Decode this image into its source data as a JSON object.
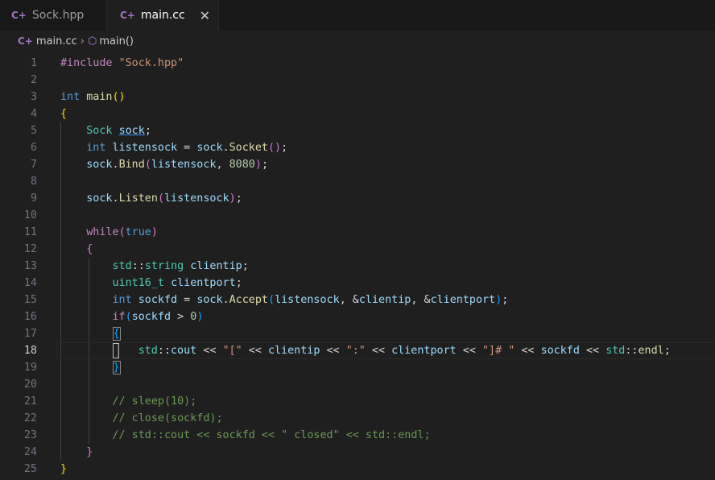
{
  "tabs": [
    {
      "label": "Sock.hpp",
      "icon": "c-plus-plus-icon"
    },
    {
      "label": "main.cc",
      "icon": "c-plus-plus-icon",
      "active": true,
      "close": "✕"
    }
  ],
  "breadcrumb": {
    "file": "main.cc",
    "sep": "›",
    "symbol": "main()"
  },
  "current_line": 18,
  "lines": [
    [
      [
        "#include ",
        "kwc"
      ],
      [
        "\"Sock.hpp\"",
        "str"
      ]
    ],
    [],
    [
      [
        "int",
        "kw"
      ],
      [
        " ",
        ""
      ],
      [
        "main",
        "fn"
      ],
      [
        "()",
        "br1"
      ]
    ],
    [
      [
        "{",
        "br1"
      ]
    ],
    [
      [
        "    ",
        ""
      ],
      [
        "Sock",
        "typ"
      ],
      [
        " ",
        ""
      ],
      [
        "sock",
        "var ul"
      ],
      [
        ";",
        "op"
      ]
    ],
    [
      [
        "    ",
        ""
      ],
      [
        "int",
        "kw"
      ],
      [
        " ",
        ""
      ],
      [
        "listensock",
        "var"
      ],
      [
        " = ",
        "op"
      ],
      [
        "sock",
        "var"
      ],
      [
        ".",
        "op"
      ],
      [
        "Socket",
        "fn"
      ],
      [
        "()",
        "br2"
      ],
      [
        ";",
        "op"
      ]
    ],
    [
      [
        "    ",
        ""
      ],
      [
        "sock",
        "var"
      ],
      [
        ".",
        "op"
      ],
      [
        "Bind",
        "fn"
      ],
      [
        "(",
        "br2"
      ],
      [
        "listensock",
        "var"
      ],
      [
        ", ",
        "op"
      ],
      [
        "8080",
        "num"
      ],
      [
        ")",
        "br2"
      ],
      [
        ";",
        "op"
      ]
    ],
    [],
    [
      [
        "    ",
        ""
      ],
      [
        "sock",
        "var"
      ],
      [
        ".",
        "op"
      ],
      [
        "Listen",
        "fn"
      ],
      [
        "(",
        "br2"
      ],
      [
        "listensock",
        "var"
      ],
      [
        ")",
        "br2"
      ],
      [
        ";",
        "op"
      ]
    ],
    [],
    [
      [
        "    ",
        ""
      ],
      [
        "while",
        "kwc"
      ],
      [
        "(",
        "br2"
      ],
      [
        "true",
        "kw"
      ],
      [
        ")",
        "br2"
      ]
    ],
    [
      [
        "    ",
        ""
      ],
      [
        "{",
        "br2"
      ]
    ],
    [
      [
        "        ",
        ""
      ],
      [
        "std",
        "typ"
      ],
      [
        "::",
        "op"
      ],
      [
        "string",
        "typ"
      ],
      [
        " ",
        ""
      ],
      [
        "clientip",
        "var"
      ],
      [
        ";",
        "op"
      ]
    ],
    [
      [
        "        ",
        ""
      ],
      [
        "uint16_t",
        "typ"
      ],
      [
        " ",
        ""
      ],
      [
        "clientport",
        "var"
      ],
      [
        ";",
        "op"
      ]
    ],
    [
      [
        "        ",
        ""
      ],
      [
        "int",
        "kw"
      ],
      [
        " ",
        ""
      ],
      [
        "sockfd",
        "var"
      ],
      [
        " = ",
        "op"
      ],
      [
        "sock",
        "var"
      ],
      [
        ".",
        "op"
      ],
      [
        "Accept",
        "fn"
      ],
      [
        "(",
        "br3"
      ],
      [
        "listensock",
        "var"
      ],
      [
        ", &",
        "op"
      ],
      [
        "clientip",
        "var"
      ],
      [
        ", &",
        "op"
      ],
      [
        "clientport",
        "var"
      ],
      [
        ")",
        "br3"
      ],
      [
        ";",
        "op"
      ]
    ],
    [
      [
        "        ",
        ""
      ],
      [
        "if",
        "kwc"
      ],
      [
        "(",
        "br3"
      ],
      [
        "sockfd",
        "var"
      ],
      [
        " > ",
        "op"
      ],
      [
        "0",
        "num"
      ],
      [
        ")",
        "br3"
      ]
    ],
    [
      [
        "        ",
        ""
      ],
      [
        "{",
        "br3 bracketbox"
      ]
    ],
    [
      [
        "        ",
        ""
      ],
      [
        "|",
        "cursor"
      ],
      [
        "   ",
        ""
      ],
      [
        "std",
        "typ"
      ],
      [
        "::",
        "op"
      ],
      [
        "cout",
        "var"
      ],
      [
        " << ",
        "op"
      ],
      [
        "\"[\"",
        "str"
      ],
      [
        " << ",
        "op"
      ],
      [
        "clientip",
        "var"
      ],
      [
        " << ",
        "op"
      ],
      [
        "\":\"",
        "str"
      ],
      [
        " << ",
        "op"
      ],
      [
        "clientport",
        "var"
      ],
      [
        " << ",
        "op"
      ],
      [
        "\"]# \"",
        "str"
      ],
      [
        " << ",
        "op"
      ],
      [
        "sockfd",
        "var"
      ],
      [
        " << ",
        "op"
      ],
      [
        "std",
        "typ"
      ],
      [
        "::",
        "op"
      ],
      [
        "endl",
        "fn"
      ],
      [
        ";",
        "op"
      ]
    ],
    [
      [
        "        ",
        ""
      ],
      [
        "}",
        "br3 bracketbox"
      ]
    ],
    [],
    [
      [
        "        ",
        ""
      ],
      [
        "// sleep(10);",
        "com"
      ]
    ],
    [
      [
        "        ",
        ""
      ],
      [
        "// close(sockfd);",
        "com"
      ]
    ],
    [
      [
        "        ",
        ""
      ],
      [
        "// std::cout << sockfd << \" closed\" << std::endl;",
        "com"
      ]
    ],
    [
      [
        "    ",
        ""
      ],
      [
        "}",
        "br2"
      ]
    ],
    [
      [
        "}",
        "br1"
      ]
    ]
  ]
}
